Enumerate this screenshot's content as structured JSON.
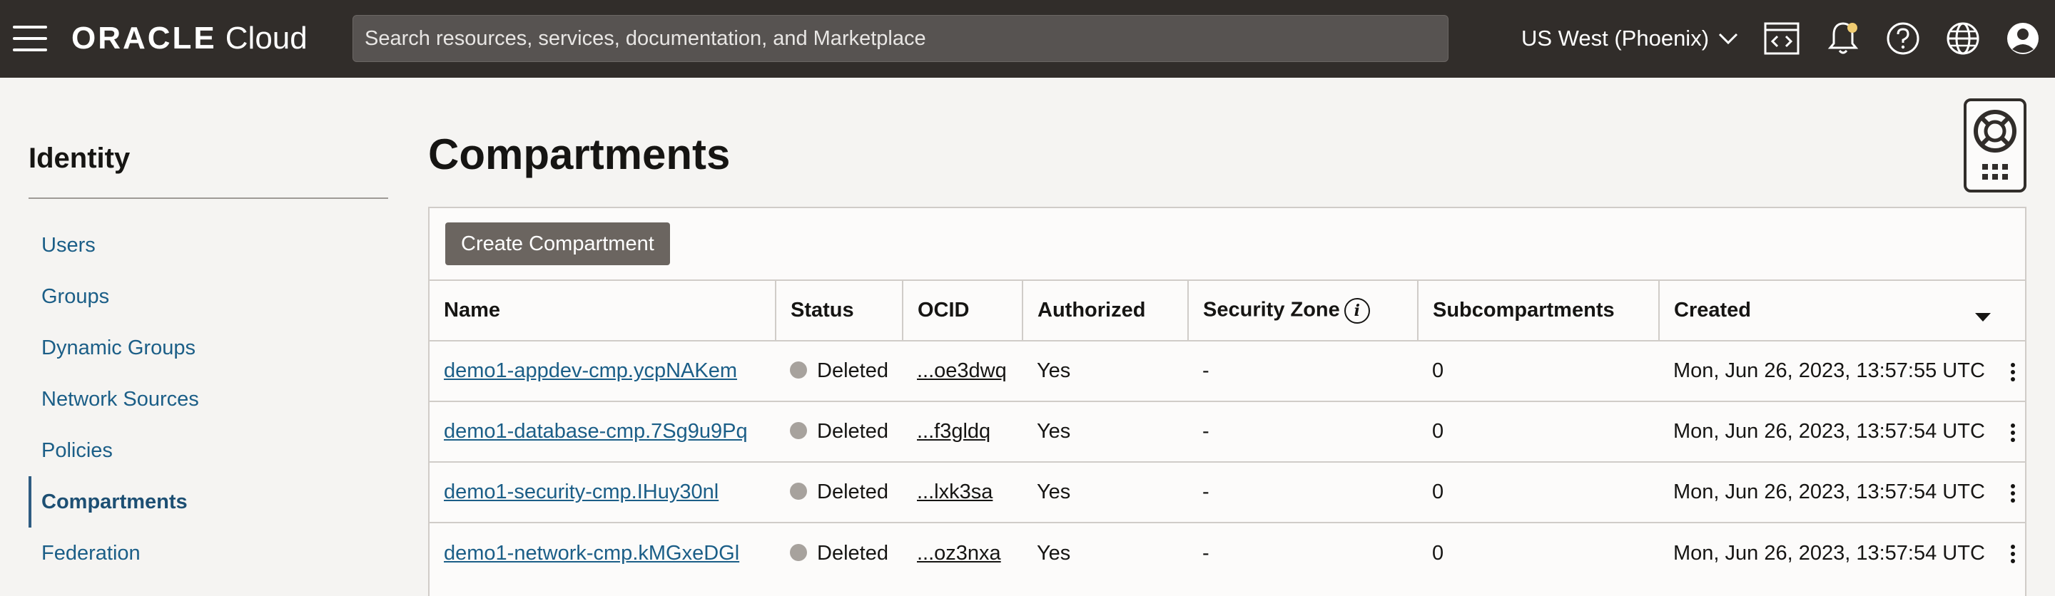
{
  "header": {
    "logo_oracle": "ORACLE",
    "logo_cloud": "Cloud",
    "search_placeholder": "Search resources, services, documentation, and Marketplace",
    "region": "US West (Phoenix)"
  },
  "sidebar": {
    "title": "Identity",
    "items": [
      {
        "label": "Users"
      },
      {
        "label": "Groups"
      },
      {
        "label": "Dynamic Groups"
      },
      {
        "label": "Network Sources"
      },
      {
        "label": "Policies"
      },
      {
        "label": "Compartments",
        "active": true
      },
      {
        "label": "Federation"
      }
    ]
  },
  "main": {
    "title": "Compartments",
    "create_button": "Create Compartment",
    "columns": [
      "Name",
      "Status",
      "OCID",
      "Authorized",
      "Security Zone",
      "Subcompartments",
      "Created"
    ],
    "rows": [
      {
        "name": "demo1-appdev-cmp.ycpNAKem",
        "status": "Deleted",
        "ocid": "...oe3dwq",
        "authorized": "Yes",
        "security_zone": "-",
        "subcompartments": "0",
        "created": "Mon, Jun 26, 2023, 13:57:55 UTC"
      },
      {
        "name": "demo1-database-cmp.7Sg9u9Pq",
        "status": "Deleted",
        "ocid": "...f3gldq",
        "authorized": "Yes",
        "security_zone": "-",
        "subcompartments": "0",
        "created": "Mon, Jun 26, 2023, 13:57:54 UTC"
      },
      {
        "name": "demo1-security-cmp.IHuy30nl",
        "status": "Deleted",
        "ocid": "...lxk3sa",
        "authorized": "Yes",
        "security_zone": "-",
        "subcompartments": "0",
        "created": "Mon, Jun 26, 2023, 13:57:54 UTC"
      },
      {
        "name": "demo1-network-cmp.kMGxeDGl",
        "status": "Deleted",
        "ocid": "...oz3nxa",
        "authorized": "Yes",
        "security_zone": "-",
        "subcompartments": "0",
        "created": "Mon, Jun 26, 2023, 13:57:54 UTC"
      }
    ]
  },
  "colors": {
    "topbar": "#312d2a",
    "link": "#1b5e87",
    "status_deleted": "#a7a29d",
    "button": "#6b6560"
  }
}
